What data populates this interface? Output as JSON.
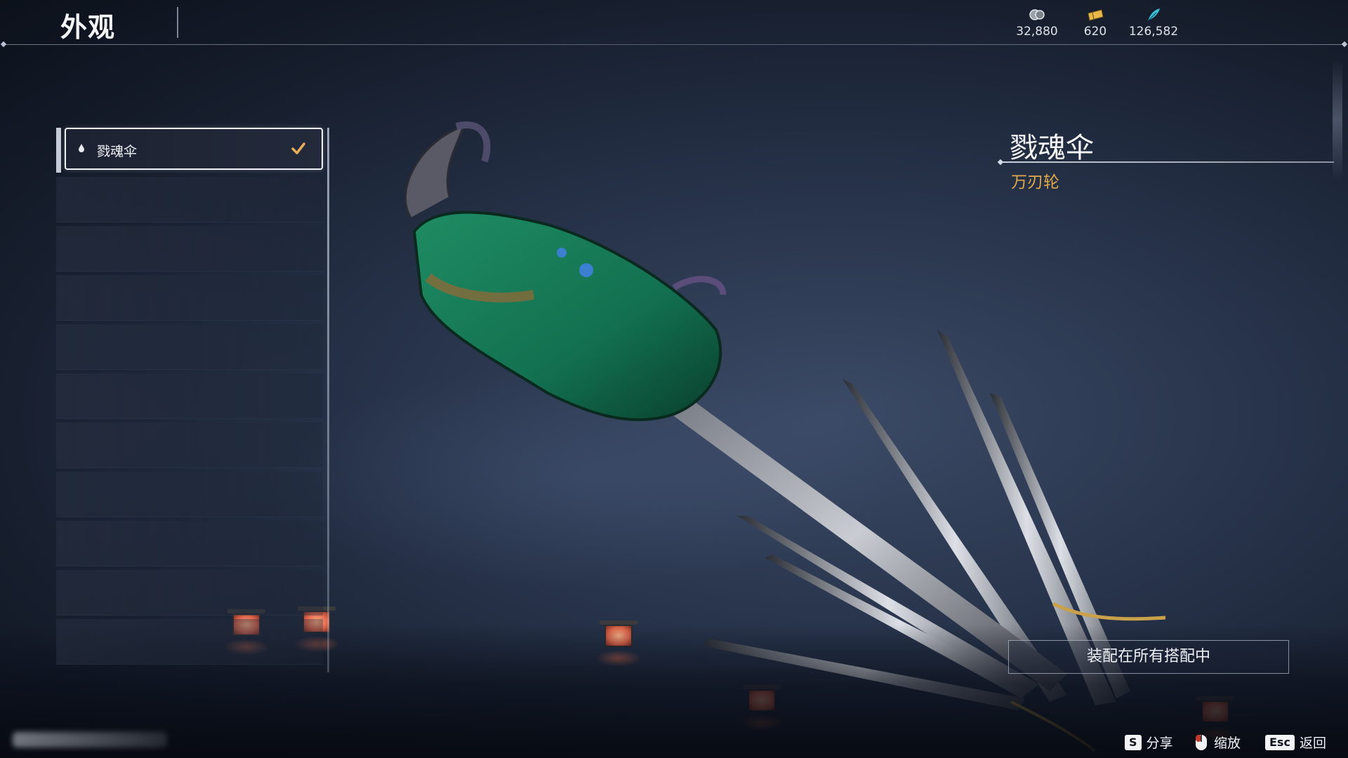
{
  "header": {
    "title": "外观",
    "currencies": [
      {
        "icon": "coin-icon",
        "value": "32,880",
        "color": "#b7bcc4"
      },
      {
        "icon": "ticket-icon",
        "value": "620",
        "color": "#e9b84a"
      },
      {
        "icon": "feather-icon",
        "value": "126,582",
        "color": "#39c0d9"
      }
    ]
  },
  "skin_list": {
    "selected_item": {
      "label": "戮魂伞",
      "icon": "drop-icon",
      "checked": true
    }
  },
  "detail": {
    "name": "戮魂伞",
    "category": "万刃轮",
    "equip_button_label": "装配在所有搭配中"
  },
  "hints": {
    "share": {
      "key": "S",
      "label": "分享"
    },
    "zoom": {
      "key": "mouse-icon",
      "label": "缩放"
    },
    "back": {
      "key": "Esc",
      "label": "返回"
    }
  },
  "colors": {
    "accent_gold": "#e0a84a",
    "background_dark": "#141b29"
  }
}
